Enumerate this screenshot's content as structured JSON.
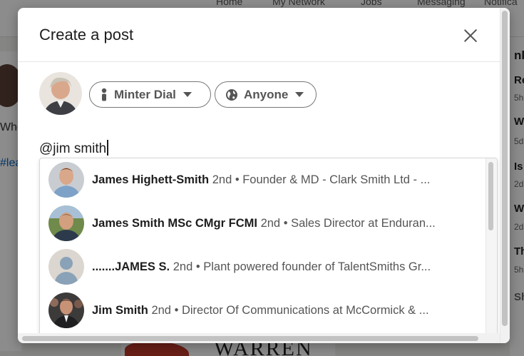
{
  "background": {
    "nav": [
      "Home",
      "My Network",
      "Jobs",
      "Messaging",
      "Notifica"
    ],
    "left_text": "Whe",
    "left_hashtag": "#lea",
    "right_items": [
      {
        "title": "Re",
        "sub": "5h"
      },
      {
        "title": "W",
        "sub": "5d"
      },
      {
        "title": "Is",
        "sub": "2d"
      },
      {
        "title": "W",
        "sub": "2d"
      },
      {
        "title": "Th",
        "sub": "5h"
      }
    ],
    "right_header": "nk",
    "right_footer": "Sh",
    "image_text": "WARREN"
  },
  "modal": {
    "title": "Create a post",
    "author_pill": "Minter Dial",
    "audience_pill": "Anyone",
    "composer_value": "@jim smith"
  },
  "mentions": [
    {
      "name": "James Highett-Smith",
      "degree": "2nd",
      "headline": "Founder & MD - Clark Smith Ltd - ...",
      "avatar": "photo-man-blue-shirt"
    },
    {
      "name": "James Smith MSc CMgr FCMI",
      "degree": "2nd",
      "headline": "Sales Director at Enduran...",
      "avatar": "photo-man-outdoor"
    },
    {
      "name": ".......JAMES S.",
      "degree": "2nd",
      "headline": "Plant powered founder of TalentSmiths Gr...",
      "avatar": "default-person-silhouette"
    },
    {
      "name": "Jim Smith",
      "degree": "2nd",
      "headline": "Director Of Communications at McCormick & ...",
      "avatar": "photo-man-crowd"
    }
  ],
  "separator": "•",
  "colors": {
    "link": "#0a66c2",
    "pill_border": "#777777",
    "text": "#1d1d1d"
  }
}
